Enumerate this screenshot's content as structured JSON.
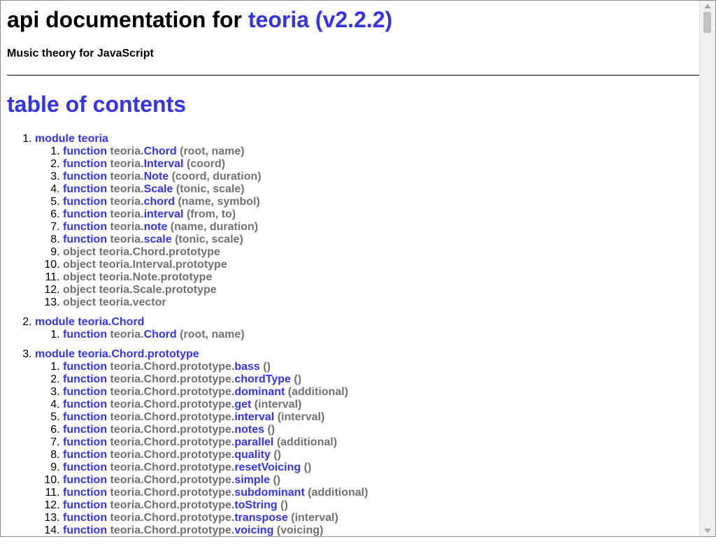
{
  "header": {
    "title_prefix": "api documentation for",
    "title_name": "teoria (v2.2.2)",
    "subtitle": "Music theory for JavaScript"
  },
  "toc": {
    "heading": "table of contents",
    "modules": [
      {
        "label": "module teoria",
        "items": [
          {
            "kind": "function",
            "prefix": "teoria.",
            "name": "Chord",
            "args": "(root, name)"
          },
          {
            "kind": "function",
            "prefix": "teoria.",
            "name": "Interval",
            "args": "(coord)"
          },
          {
            "kind": "function",
            "prefix": "teoria.",
            "name": "Note",
            "args": "(coord, duration)"
          },
          {
            "kind": "function",
            "prefix": "teoria.",
            "name": "Scale",
            "args": "(tonic, scale)"
          },
          {
            "kind": "function",
            "prefix": "teoria.",
            "name": "chord",
            "args": "(name, symbol)"
          },
          {
            "kind": "function",
            "prefix": "teoria.",
            "name": "interval",
            "args": "(from, to)"
          },
          {
            "kind": "function",
            "prefix": "teoria.",
            "name": "note",
            "args": "(name, duration)"
          },
          {
            "kind": "function",
            "prefix": "teoria.",
            "name": "scale",
            "args": "(tonic, scale)"
          },
          {
            "kind": "object",
            "text": "object teoria.Chord.prototype"
          },
          {
            "kind": "object",
            "text": "object teoria.Interval.prototype"
          },
          {
            "kind": "object",
            "text": "object teoria.Note.prototype"
          },
          {
            "kind": "object",
            "text": "object teoria.Scale.prototype"
          },
          {
            "kind": "object",
            "text": "object teoria.vector"
          }
        ]
      },
      {
        "label": "module teoria.Chord",
        "items": [
          {
            "kind": "function",
            "prefix": "teoria.",
            "name": "Chord",
            "args": "(root, name)"
          }
        ]
      },
      {
        "label": "module teoria.Chord.prototype",
        "items": [
          {
            "kind": "function",
            "prefix": "teoria.Chord.prototype.",
            "name": "bass",
            "args": "()"
          },
          {
            "kind": "function",
            "prefix": "teoria.Chord.prototype.",
            "name": "chordType",
            "args": "()"
          },
          {
            "kind": "function",
            "prefix": "teoria.Chord.prototype.",
            "name": "dominant",
            "args": "(additional)"
          },
          {
            "kind": "function",
            "prefix": "teoria.Chord.prototype.",
            "name": "get",
            "args": "(interval)"
          },
          {
            "kind": "function",
            "prefix": "teoria.Chord.prototype.",
            "name": "interval",
            "args": "(interval)"
          },
          {
            "kind": "function",
            "prefix": "teoria.Chord.prototype.",
            "name": "notes",
            "args": "()"
          },
          {
            "kind": "function",
            "prefix": "teoria.Chord.prototype.",
            "name": "parallel",
            "args": "(additional)"
          },
          {
            "kind": "function",
            "prefix": "teoria.Chord.prototype.",
            "name": "quality",
            "args": "()"
          },
          {
            "kind": "function",
            "prefix": "teoria.Chord.prototype.",
            "name": "resetVoicing",
            "args": "()"
          },
          {
            "kind": "function",
            "prefix": "teoria.Chord.prototype.",
            "name": "simple",
            "args": "()"
          },
          {
            "kind": "function",
            "prefix": "teoria.Chord.prototype.",
            "name": "subdominant",
            "args": "(additional)"
          },
          {
            "kind": "function",
            "prefix": "teoria.Chord.prototype.",
            "name": "toString",
            "args": "()"
          },
          {
            "kind": "function",
            "prefix": "teoria.Chord.prototype.",
            "name": "transpose",
            "args": "(interval)"
          },
          {
            "kind": "function",
            "prefix": "teoria.Chord.prototype.",
            "name": "voicing",
            "args": "(voicing)"
          }
        ]
      }
    ]
  },
  "colors": {
    "link": "#3333ee",
    "muted": "#707070"
  }
}
